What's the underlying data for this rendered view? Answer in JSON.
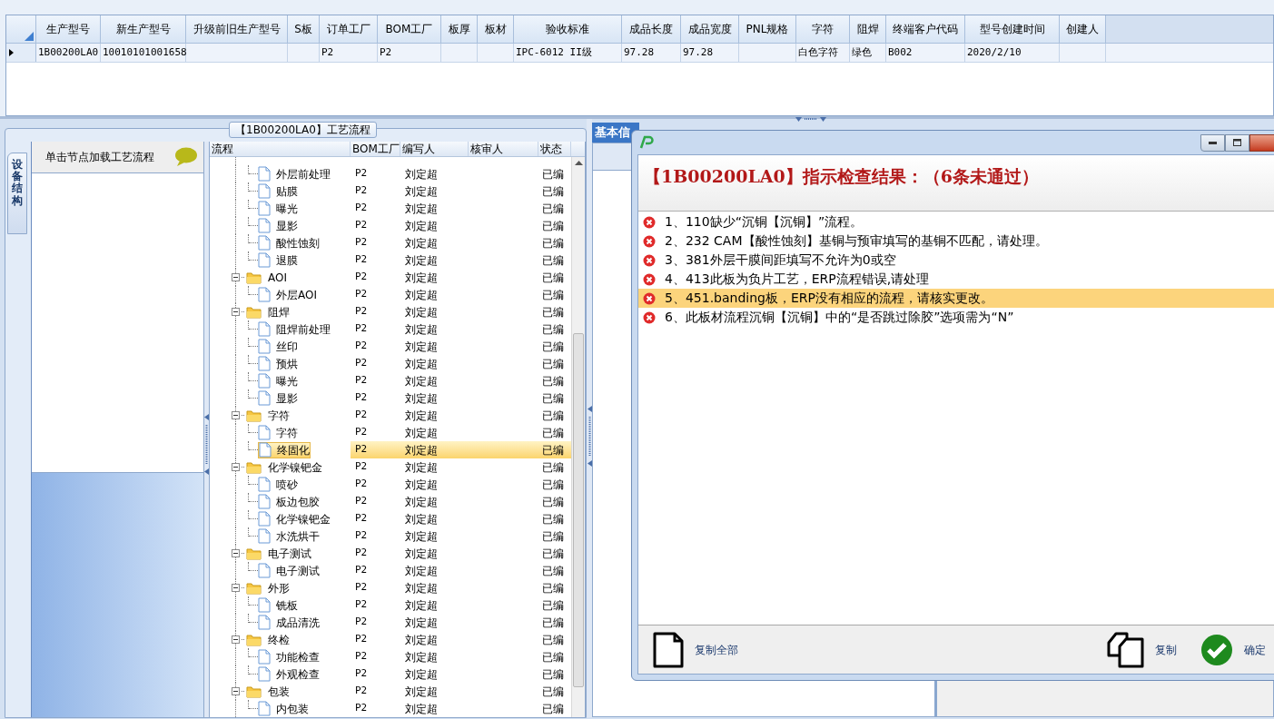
{
  "main_grid": {
    "columns": [
      "生产型号",
      "新生产型号",
      "升级前旧生产型号",
      "S板",
      "订单工厂",
      "BOM工厂",
      "板厚",
      "板材",
      "验收标准",
      "成品长度",
      "成品宽度",
      "PNL规格",
      "字符",
      "阻焊",
      "终端客户代码",
      "型号创建时间",
      "创建人"
    ],
    "rows": [
      {
        "selected": true,
        "cells": [
          "1B00200LA0",
          "10010101001658",
          "",
          "",
          "P2",
          "P2",
          "",
          "",
          "IPC-6012 II级",
          "97.28",
          "97.28",
          "",
          "白色字符",
          "绿色",
          "B002",
          "2020/2/10",
          ""
        ]
      }
    ]
  },
  "process_box": {
    "title": "【1B00200LA0】工艺流程"
  },
  "side_tab": {
    "label": "设备结构"
  },
  "node_panel": {
    "header": "单击节点加载工艺流程"
  },
  "process_tree": {
    "columns": [
      "流程",
      "BOM工厂",
      "编写人",
      "核审人",
      "状态"
    ],
    "nodes": [
      {
        "kind": "folder",
        "children": [
          {
            "kind": "step",
            "label": "外层前处理",
            "bom": "P2",
            "author": "刘定超",
            "status": "已编",
            "selected": false
          },
          {
            "kind": "step",
            "label": "贴膜",
            "bom": "P2",
            "author": "刘定超",
            "status": "已编",
            "selected": false
          },
          {
            "kind": "step",
            "label": "曝光",
            "bom": "P2",
            "author": "刘定超",
            "status": "已编",
            "selected": false
          },
          {
            "kind": "step",
            "label": "显影",
            "bom": "P2",
            "author": "刘定超",
            "status": "已编",
            "selected": false
          },
          {
            "kind": "step",
            "label": "酸性蚀刻",
            "bom": "P2",
            "author": "刘定超",
            "status": "已编",
            "selected": false
          },
          {
            "kind": "step",
            "label": "退膜",
            "bom": "P2",
            "author": "刘定超",
            "status": "已编",
            "selected": false
          }
        ]
      },
      {
        "kind": "folder",
        "label": "AOI",
        "bom": "P2",
        "author": "刘定超",
        "status": "已编",
        "expanded": true,
        "selected": false,
        "children": [
          {
            "kind": "step",
            "label": "外层AOI",
            "bom": "P2",
            "author": "刘定超",
            "status": "已编",
            "selected": false
          }
        ]
      },
      {
        "kind": "folder",
        "label": "阻焊",
        "bom": "P2",
        "author": "刘定超",
        "status": "已编",
        "expanded": true,
        "selected": false,
        "children": [
          {
            "kind": "step",
            "label": "阻焊前处理",
            "bom": "P2",
            "author": "刘定超",
            "status": "已编",
            "selected": false
          },
          {
            "kind": "step",
            "label": "丝印",
            "bom": "P2",
            "author": "刘定超",
            "status": "已编",
            "selected": false
          },
          {
            "kind": "step",
            "label": "预烘",
            "bom": "P2",
            "author": "刘定超",
            "status": "已编",
            "selected": false
          },
          {
            "kind": "step",
            "label": "曝光",
            "bom": "P2",
            "author": "刘定超",
            "status": "已编",
            "selected": false
          },
          {
            "kind": "step",
            "label": "显影",
            "bom": "P2",
            "author": "刘定超",
            "status": "已编",
            "selected": false
          }
        ]
      },
      {
        "kind": "folder",
        "label": "字符",
        "bom": "P2",
        "author": "刘定超",
        "status": "已编",
        "expanded": true,
        "selected": false,
        "children": [
          {
            "kind": "step",
            "label": "字符",
            "bom": "P2",
            "author": "刘定超",
            "status": "已编",
            "selected": false
          },
          {
            "kind": "step",
            "label": "终固化",
            "bom": "P2",
            "author": "刘定超",
            "status": "已编",
            "selected": true
          }
        ]
      },
      {
        "kind": "folder",
        "label": "化学镍钯金",
        "bom": "P2",
        "author": "刘定超",
        "status": "已编",
        "expanded": true,
        "selected": false,
        "children": [
          {
            "kind": "step",
            "label": "喷砂",
            "bom": "P2",
            "author": "刘定超",
            "status": "已编",
            "selected": false
          },
          {
            "kind": "step",
            "label": "板边包胶",
            "bom": "P2",
            "author": "刘定超",
            "status": "已编",
            "selected": false
          },
          {
            "kind": "step",
            "label": "化学镍钯金",
            "bom": "P2",
            "author": "刘定超",
            "status": "已编",
            "selected": false
          },
          {
            "kind": "step",
            "label": "水洗烘干",
            "bom": "P2",
            "author": "刘定超",
            "status": "已编",
            "selected": false
          }
        ]
      },
      {
        "kind": "folder",
        "label": "电子测试",
        "bom": "P2",
        "author": "刘定超",
        "status": "已编",
        "expanded": true,
        "selected": false,
        "children": [
          {
            "kind": "step",
            "label": "电子测试",
            "bom": "P2",
            "author": "刘定超",
            "status": "已编",
            "selected": false
          }
        ]
      },
      {
        "kind": "folder",
        "label": "外形",
        "bom": "P2",
        "author": "刘定超",
        "status": "已编",
        "expanded": true,
        "selected": false,
        "children": [
          {
            "kind": "step",
            "label": "铣板",
            "bom": "P2",
            "author": "刘定超",
            "status": "已编",
            "selected": false
          },
          {
            "kind": "step",
            "label": "成品清洗",
            "bom": "P2",
            "author": "刘定超",
            "status": "已编",
            "selected": false
          }
        ]
      },
      {
        "kind": "folder",
        "label": "终检",
        "bom": "P2",
        "author": "刘定超",
        "status": "已编",
        "expanded": true,
        "selected": false,
        "children": [
          {
            "kind": "step",
            "label": "功能检查",
            "bom": "P2",
            "author": "刘定超",
            "status": "已编",
            "selected": false
          },
          {
            "kind": "step",
            "label": "外观检查",
            "bom": "P2",
            "author": "刘定超",
            "status": "已编",
            "selected": false
          }
        ]
      },
      {
        "kind": "folder",
        "label": "包装",
        "bom": "P2",
        "author": "刘定超",
        "status": "已编",
        "expanded": true,
        "selected": false,
        "children": [
          {
            "kind": "step",
            "label": "内包装",
            "bom": "P2",
            "author": "刘定超",
            "status": "已编",
            "selected": false
          }
        ]
      }
    ]
  },
  "right_panel": {
    "tab": "基本信"
  },
  "dialog": {
    "heading": "【1B00200LA0】指示检查结果：（6条未通过）",
    "results": [
      {
        "text": "1、110缺少“沉铜【沉铜】”流程。",
        "selected": false
      },
      {
        "text": "2、232 CAM【酸性蚀刻】基铜与预审填写的基铜不匹配，请处理。",
        "selected": false
      },
      {
        "text": "3、381外层干膜间距填写不允许为0或空",
        "selected": false
      },
      {
        "text": "4、413此板为负片工艺，ERP流程错误,请处理",
        "selected": false
      },
      {
        "text": "5、451.banding板，ERP没有相应的流程，请核实更改。",
        "selected": true
      },
      {
        "text": "6、此板材流程沉铜【沉铜】中的“是否跳过除胶”选项需为“N”",
        "selected": false
      }
    ],
    "buttons": [
      {
        "kind": "copy_all",
        "label": "复制全部"
      },
      {
        "kind": "copy",
        "label": "复制"
      },
      {
        "kind": "ok",
        "label": "确定"
      }
    ]
  }
}
